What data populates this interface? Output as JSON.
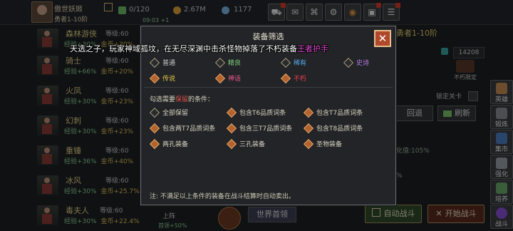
{
  "colors": {
    "quality_common": "#c9c9c9",
    "quality_fine": "#7ed07a",
    "quality_rare": "#56a8e6",
    "quality_epic": "#b579e3",
    "quality_legendary": "#e6c34a",
    "quality_mythic": "#e8568a",
    "quality_immortal": "#e8404a",
    "highlight_red": "#e0534a",
    "announce_magenta": "#e44bd3"
  },
  "header": {
    "player_name": "傲世妖姬",
    "player_rank": "勇者1-10阶",
    "stamina": "0/120",
    "gold": "2.67M",
    "gems": "1177",
    "timer": "09:03 +1",
    "icons": [
      "shop-cart-icon",
      "mail-icon",
      "gamepad-icon",
      "settings-gear-icon",
      "color-wheel-icon",
      "chest-icon",
      "menu-icon"
    ]
  },
  "heroes": [
    {
      "name": "森林游侠",
      "level": "等级:60",
      "exp": "经验+30%",
      "gold": "金币+30%"
    },
    {
      "name": "骑士",
      "level": "等级:60",
      "exp": "经验+66%",
      "gold": "金币+20%"
    },
    {
      "name": "火凤",
      "level": "等级:60",
      "exp": "经验+30%",
      "gold": "金币+23%"
    },
    {
      "name": "幻刺",
      "level": "等级:60",
      "exp": "经验+30%",
      "gold": "金币+23%"
    },
    {
      "name": "重锤",
      "level": "等级:60",
      "exp": "经验+36%",
      "gold": "金币+40%"
    },
    {
      "name": "冰风",
      "level": "等级:60",
      "exp": "经验+30%",
      "gold": "金币+25.7%"
    },
    {
      "name": "毒夫人",
      "level": "等级:60",
      "exp": "经验+30%",
      "gold": "金币+22.4%"
    }
  ],
  "right_panel": {
    "title": "勇者1-10阶",
    "count": "14208",
    "relic_label": "不朽限定",
    "lock_label": "锁定关卡",
    "rewind_label": "回退",
    "refresh_label": "刷新",
    "reward_text": "化值:105%",
    "reward_text2": "%",
    "side_nav": [
      "英雄",
      "锻炼",
      "集市",
      "强化",
      "培养",
      "战斗"
    ],
    "auto_battle_label": "自动战斗",
    "start_battle_label": "开始战斗",
    "up_label": "上阵",
    "bottom_partial": "世界首领",
    "bottom_partial2": "首领+50%"
  },
  "banner": {
    "text": "天选之子，玩家神域孤坟，在无尽深渊中击杀怪物掉落了不朽装备",
    "item": "王者护手"
  },
  "modal": {
    "title": "装备筛选",
    "quality_options": [
      {
        "label": "普通",
        "checked": false,
        "color_key": "quality_common"
      },
      {
        "label": "精良",
        "checked": false,
        "color_key": "quality_fine"
      },
      {
        "label": "稀有",
        "checked": false,
        "color_key": "quality_rare"
      },
      {
        "label": "史诗",
        "checked": false,
        "color_key": "quality_epic"
      },
      {
        "label": "传说",
        "checked": true,
        "color_key": "quality_legendary"
      },
      {
        "label": "神话",
        "checked": true,
        "color_key": "quality_mythic"
      },
      {
        "label": "不朽",
        "checked": true,
        "color_key": "quality_immortal"
      }
    ],
    "cond_prefix": "勾选需要",
    "cond_highlight": "保留",
    "cond_suffix": "的条件：",
    "conditions": [
      {
        "label": "全部保留",
        "checked": false
      },
      {
        "label": "包含T6品质词条",
        "checked": true
      },
      {
        "label": "包含T7品质词条",
        "checked": true
      },
      {
        "label": "包含两T7品质词条",
        "checked": true
      },
      {
        "label": "包含三T7品质词条",
        "checked": true
      },
      {
        "label": "包含T8品质词条",
        "checked": true
      },
      {
        "label": "两孔装备",
        "checked": true
      },
      {
        "label": "三孔装备",
        "checked": true
      },
      {
        "label": "圣物装备",
        "checked": true
      }
    ],
    "note": "注:  不满足以上条件的装备在战斗结算时自动卖出。"
  }
}
